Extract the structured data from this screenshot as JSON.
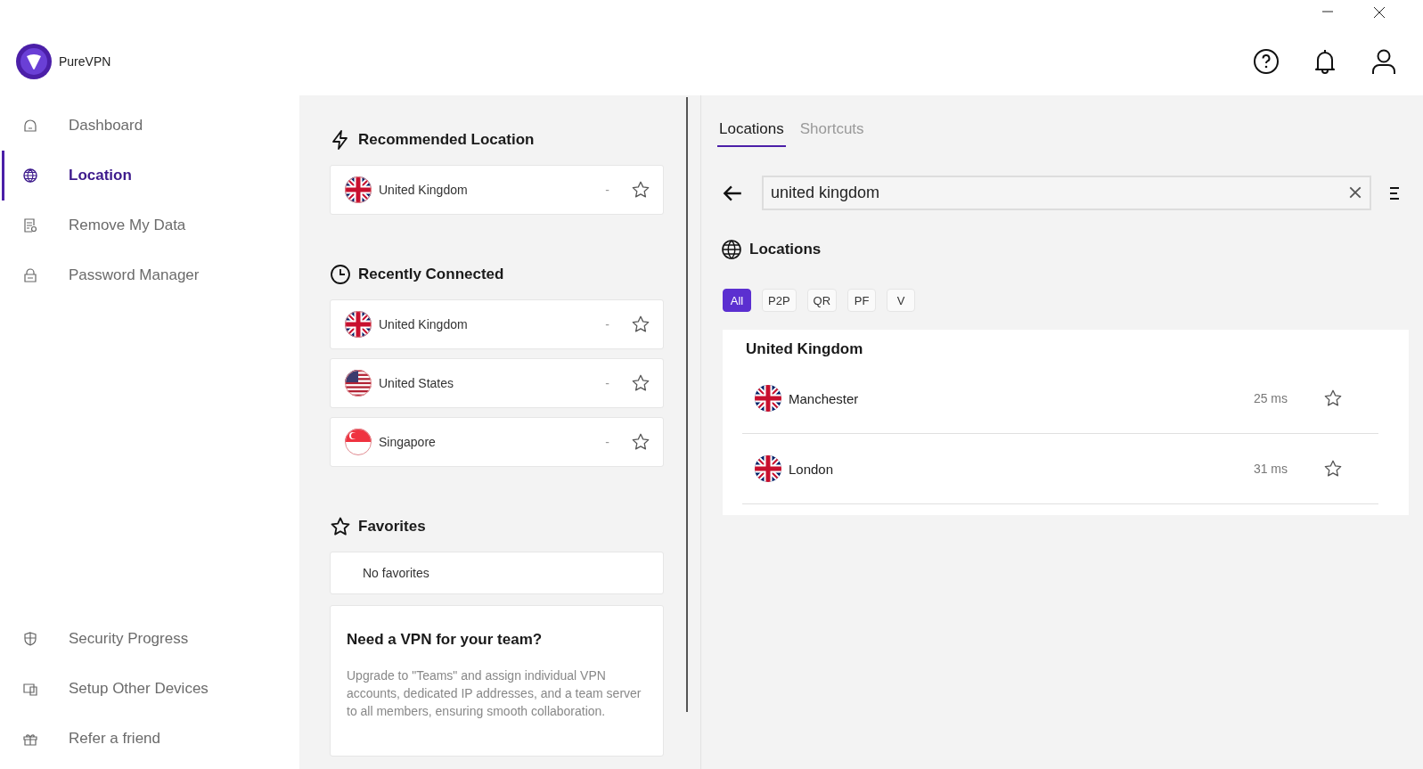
{
  "app": {
    "name": "PureVPN"
  },
  "sidebar": {
    "items": [
      {
        "label": "Dashboard",
        "selected": false
      },
      {
        "label": "Location",
        "selected": true
      },
      {
        "label": "Remove My Data",
        "selected": false
      },
      {
        "label": "Password Manager",
        "selected": false
      }
    ],
    "footer_items": [
      {
        "label": "Security Progress"
      },
      {
        "label": "Setup Other Devices"
      },
      {
        "label": "Refer a friend"
      }
    ]
  },
  "recommended": {
    "title": "Recommended Location",
    "items": [
      {
        "name": "United Kingdom",
        "kind": "uk",
        "ping": "-",
        "favorite": false
      }
    ]
  },
  "recent": {
    "title": "Recently Connected",
    "items": [
      {
        "name": "United Kingdom",
        "kind": "uk",
        "ping": "-",
        "favorite": false
      },
      {
        "name": "United States",
        "kind": "us",
        "ping": "-",
        "favorite": false
      },
      {
        "name": "Singapore",
        "kind": "sg",
        "ping": "-",
        "favorite": false
      }
    ]
  },
  "favorites": {
    "title": "Favorites",
    "empty_text": "No favorites"
  },
  "promo": {
    "title": "Need a VPN for your team?",
    "text": "Upgrade to \"Teams\" and assign individual VPN accounts, dedicated IP addresses, and a team server to all members, ensuring smooth collaboration."
  },
  "tabs": [
    {
      "label": "Locations",
      "selected": true
    },
    {
      "label": "Shortcuts",
      "selected": false
    }
  ],
  "search": {
    "value": "united kingdom"
  },
  "locations": {
    "title": "Locations",
    "filters": [
      {
        "label": "All",
        "selected": true
      },
      {
        "label": "P2P",
        "selected": false
      },
      {
        "label": "QR",
        "selected": false
      },
      {
        "label": "PF",
        "selected": false
      },
      {
        "label": "V",
        "selected": false
      }
    ],
    "group": {
      "title": "United Kingdom",
      "cities": [
        {
          "name": "Manchester",
          "kind": "uk",
          "ping": "25 ms",
          "favorite": false
        },
        {
          "name": "London",
          "kind": "uk",
          "ping": "31 ms",
          "favorite": false
        }
      ]
    }
  }
}
